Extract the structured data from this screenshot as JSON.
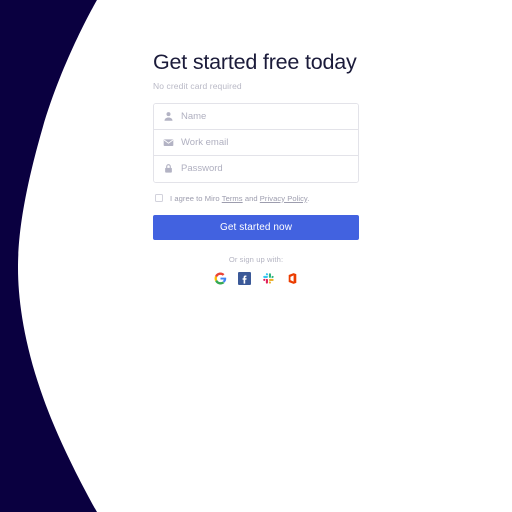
{
  "page": {
    "title": "Get started free today",
    "subtitle": "No credit card required"
  },
  "form": {
    "fields": [
      {
        "name": "name",
        "icon": "person-icon",
        "placeholder": "Name",
        "value": ""
      },
      {
        "name": "email",
        "icon": "envelope-icon",
        "placeholder": "Work email",
        "value": ""
      },
      {
        "name": "password",
        "icon": "lock-icon",
        "placeholder": "Password",
        "value": ""
      }
    ],
    "terms": {
      "checked": false,
      "prefix": "I agree to Miro ",
      "terms_link": "Terms",
      "conjunction": " and ",
      "privacy_link": "Privacy Policy",
      "suffix": "."
    },
    "submit_label": "Get started now"
  },
  "social": {
    "label": "Or sign up with:",
    "providers": [
      {
        "name": "google",
        "icon": "google-icon"
      },
      {
        "name": "facebook",
        "icon": "facebook-icon"
      },
      {
        "name": "slack",
        "icon": "slack-icon"
      },
      {
        "name": "office365",
        "icon": "office-icon"
      }
    ]
  },
  "colors": {
    "navy_decor": "#0a0040",
    "accent_button": "#4262e0",
    "heading": "#1b1b3a",
    "muted_text": "#b4b4c2",
    "field_border": "#e3e3e9"
  }
}
